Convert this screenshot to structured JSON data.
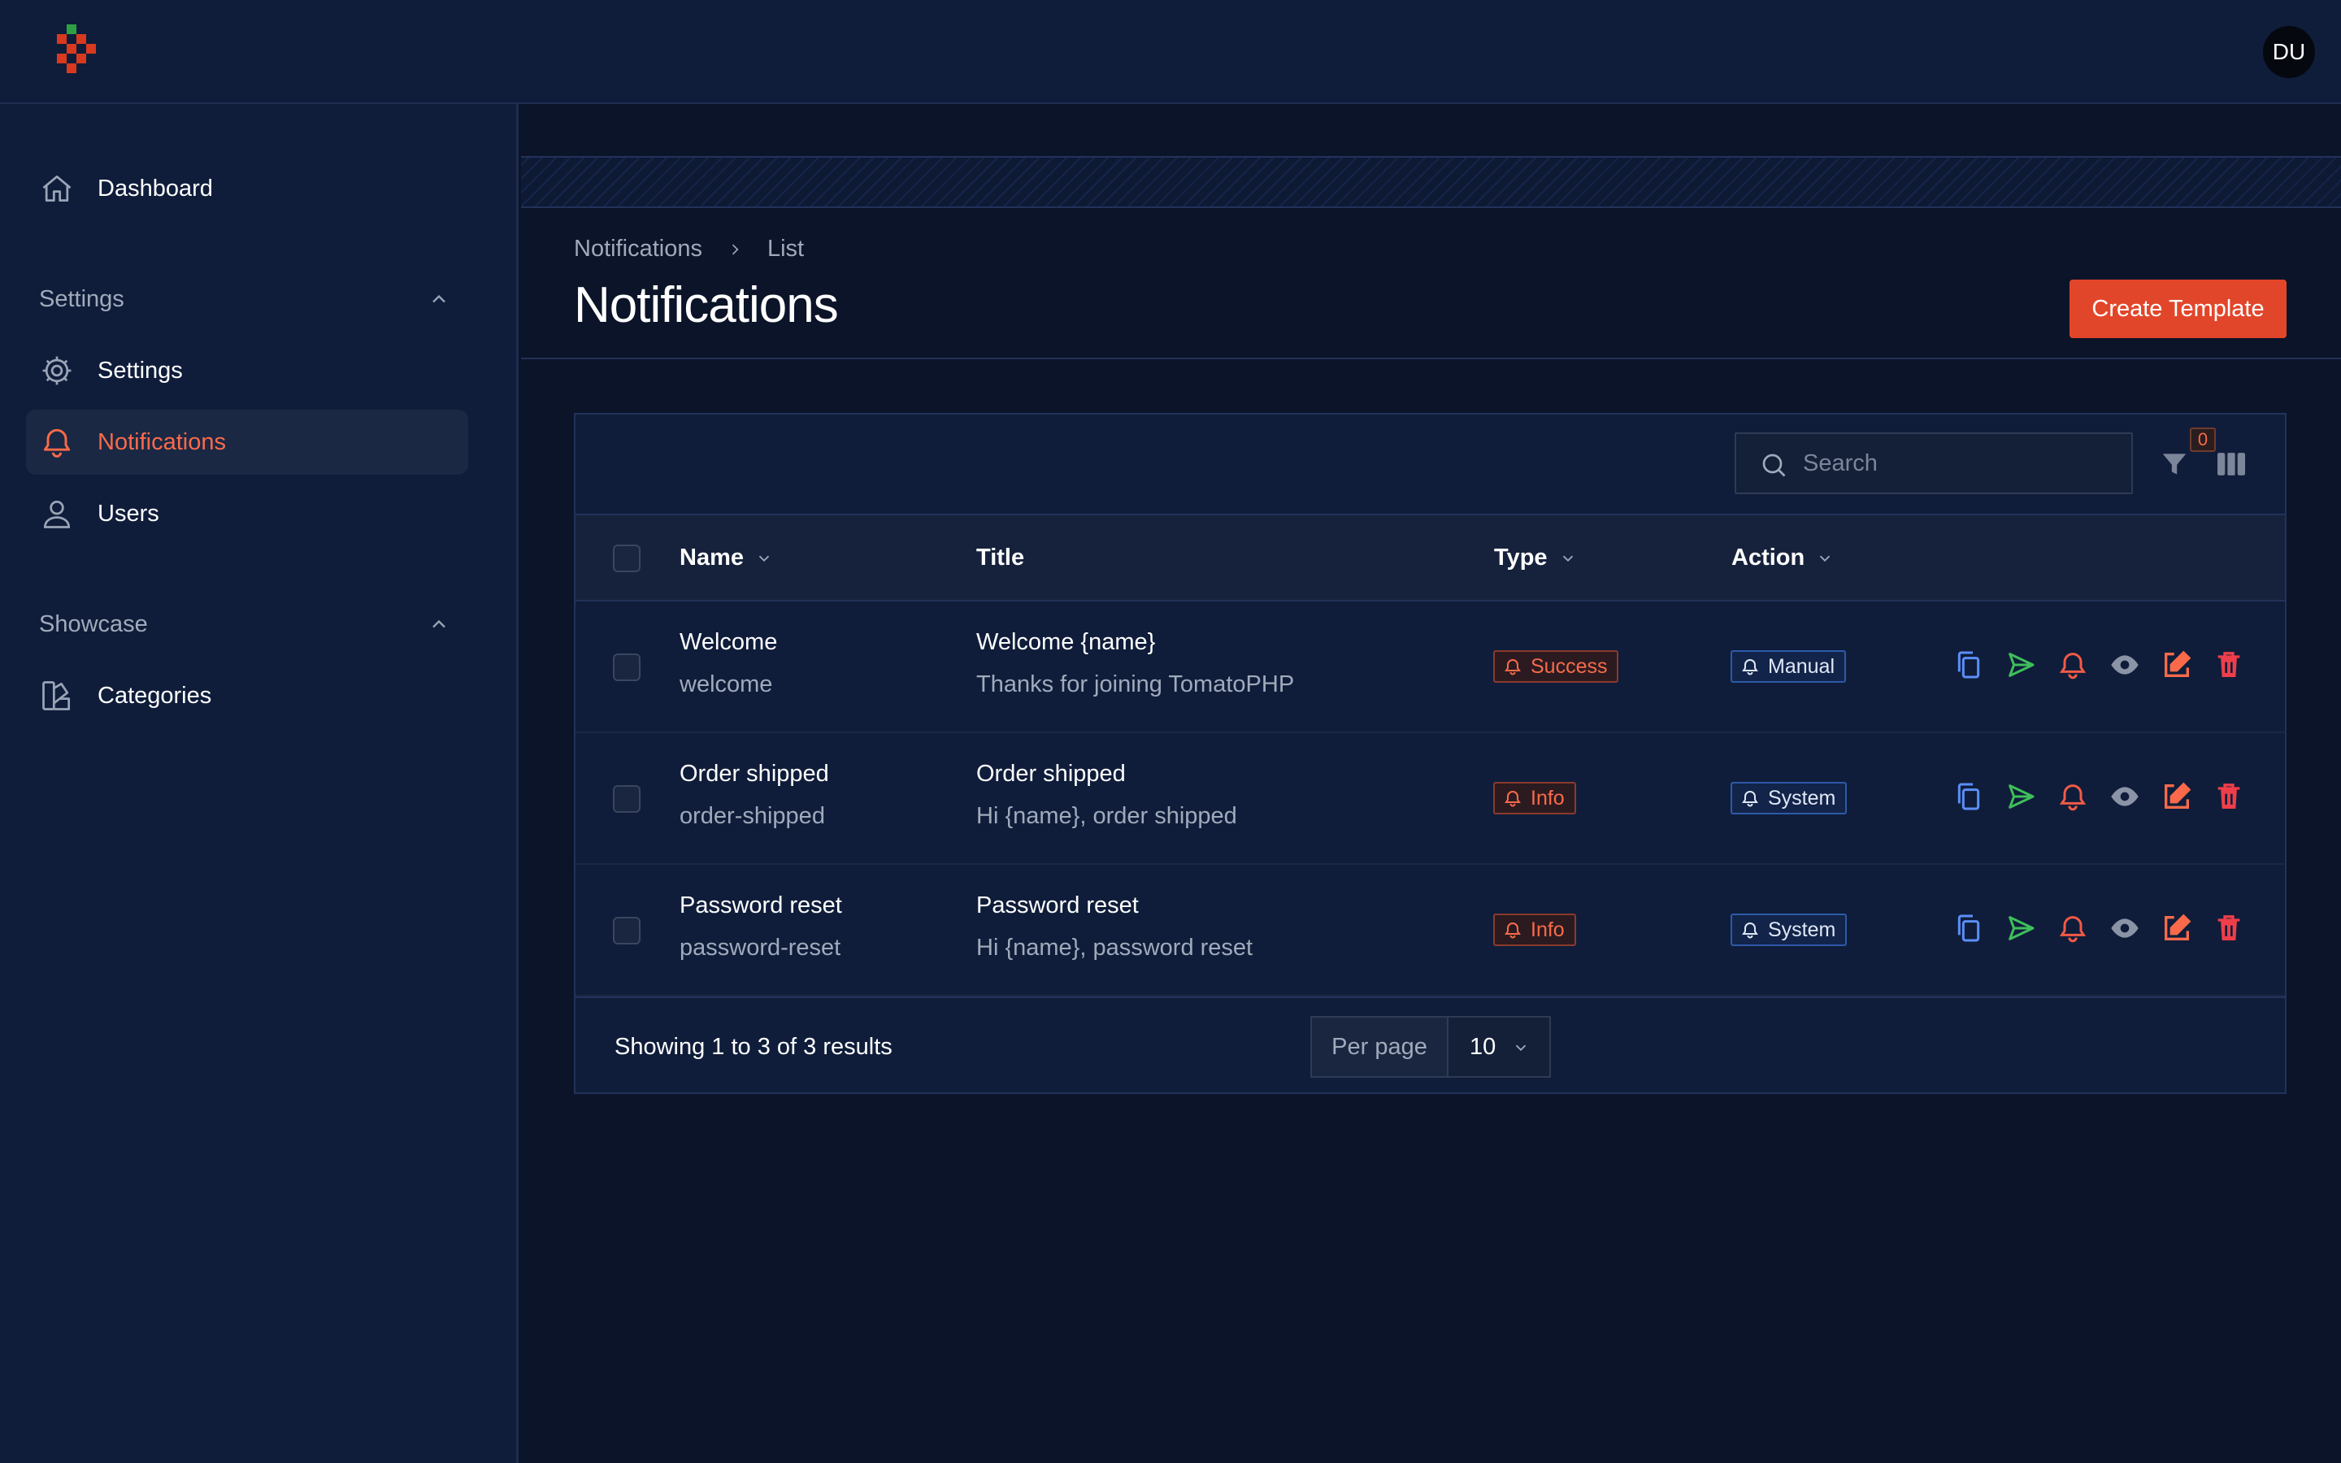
{
  "colors": {
    "accent": "#e2462a",
    "accent_text": "#fa6a4a",
    "background": "#0b1428",
    "panel": "#0f1d3a"
  },
  "header": {
    "avatar_initials": "DU"
  },
  "sidebar": {
    "dashboard": {
      "label": "Dashboard",
      "icon": "home-icon"
    },
    "groups": [
      {
        "label": "Settings",
        "items": [
          {
            "label": "Settings",
            "icon": "gear-icon"
          },
          {
            "label": "Notifications",
            "icon": "bell-icon",
            "active": true
          },
          {
            "label": "Users",
            "icon": "user-icon"
          }
        ]
      },
      {
        "label": "Showcase",
        "items": [
          {
            "label": "Categories",
            "icon": "swatch-icon"
          }
        ]
      }
    ]
  },
  "breadcrumb": [
    "Notifications",
    "List"
  ],
  "page": {
    "title": "Notifications",
    "create_button": "Create Template"
  },
  "table": {
    "search_placeholder": "Search",
    "filter_count": "0",
    "columns": [
      "Name",
      "Title",
      "Type",
      "Action"
    ],
    "rows": [
      {
        "name": "Welcome",
        "slug": "welcome",
        "title": "Welcome {name}",
        "body": "Thanks for joining TomatoPHP",
        "type": "Success",
        "action": "Manual"
      },
      {
        "name": "Order shipped",
        "slug": "order-shipped",
        "title": "Order shipped",
        "body": "Hi {name}, order shipped",
        "type": "Info",
        "action": "System"
      },
      {
        "name": "Password reset",
        "slug": "password-reset",
        "title": "Password reset",
        "body": "Hi {name}, password reset",
        "type": "Info",
        "action": "System"
      }
    ],
    "row_action_icons": [
      "copy-icon",
      "send-icon",
      "bell-icon",
      "eye-icon",
      "edit-icon",
      "trash-icon"
    ],
    "footer": {
      "showing": "Showing 1 to 3 of 3 results",
      "per_page_label": "Per page",
      "per_page_value": "10"
    }
  }
}
